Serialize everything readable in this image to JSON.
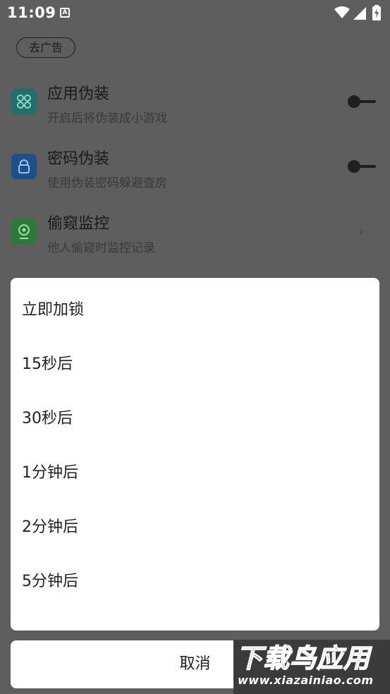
{
  "status_bar": {
    "time": "11:09",
    "notification_icon": "A"
  },
  "page": {
    "remove_ads": "去广告",
    "rows": [
      {
        "icon": "apps-grid-icon",
        "icon_color": "#1f6f6a",
        "title": "应用伪装",
        "subtitle": "开启后将伪装成小游戏",
        "control": "toggle"
      },
      {
        "icon": "lock-icon",
        "icon_color": "#1d4f8a",
        "title": "密码伪装",
        "subtitle": "使用伪装密码躲避查房",
        "control": "toggle"
      },
      {
        "icon": "camera-icon",
        "icon_color": "#2c7a37",
        "title": "偷窥监控",
        "subtitle": "他人偷窥时监控记录",
        "control": "chevron"
      }
    ]
  },
  "dialog": {
    "options": [
      "立即加锁",
      "15秒后",
      "30秒后",
      "1分钟后",
      "2分钟后",
      "5分钟后"
    ],
    "cancel": "取消"
  },
  "watermark": {
    "title": "下载鸟应用",
    "url": "www.xiazainiao.com"
  },
  "colors": {
    "scrim": "#5e5e5e",
    "dialog_bg": "#ffffff",
    "text": "#212121"
  }
}
